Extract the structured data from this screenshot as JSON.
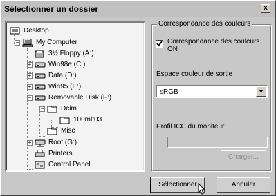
{
  "window": {
    "title": "Sélectionner un dossier",
    "close_label": "x"
  },
  "tree": {
    "items": [
      {
        "label": "Desktop",
        "icon": "desktop-icon"
      },
      {
        "label": "My Computer",
        "icon": "computer-icon"
      },
      {
        "label": "3½ Floppy (A:)",
        "icon": "floppy-icon"
      },
      {
        "label": "Win98e (C:)",
        "icon": "drive-icon"
      },
      {
        "label": "Data (D:)",
        "icon": "drive-icon"
      },
      {
        "label": "Win95 (E:)",
        "icon": "drive-icon"
      },
      {
        "label": "Removable Disk (F:)",
        "icon": "drive-icon"
      },
      {
        "label": "Dcim",
        "icon": "folder-icon"
      },
      {
        "label": "100mlt03",
        "icon": "folder-icon"
      },
      {
        "label": "Misc",
        "icon": "folder-icon"
      },
      {
        "label": "Root (G:)",
        "icon": "network-drive-icon"
      },
      {
        "label": "Printers",
        "icon": "printer-icon"
      },
      {
        "label": "Control Panel",
        "icon": "control-panel-icon"
      }
    ]
  },
  "group": {
    "title": "Correspondance des couleurs",
    "checkbox_label": "Correspondance des couleurs ON",
    "checkbox_checked": true,
    "output_label": "Espace couleur de sortie",
    "output_value": "sRGB",
    "icc_label": "Profil ICC du moniteur",
    "icc_value": "",
    "charger_label": "Charger..."
  },
  "buttons": {
    "select_label": "Sélectionner",
    "cancel_label": "Annuler"
  }
}
